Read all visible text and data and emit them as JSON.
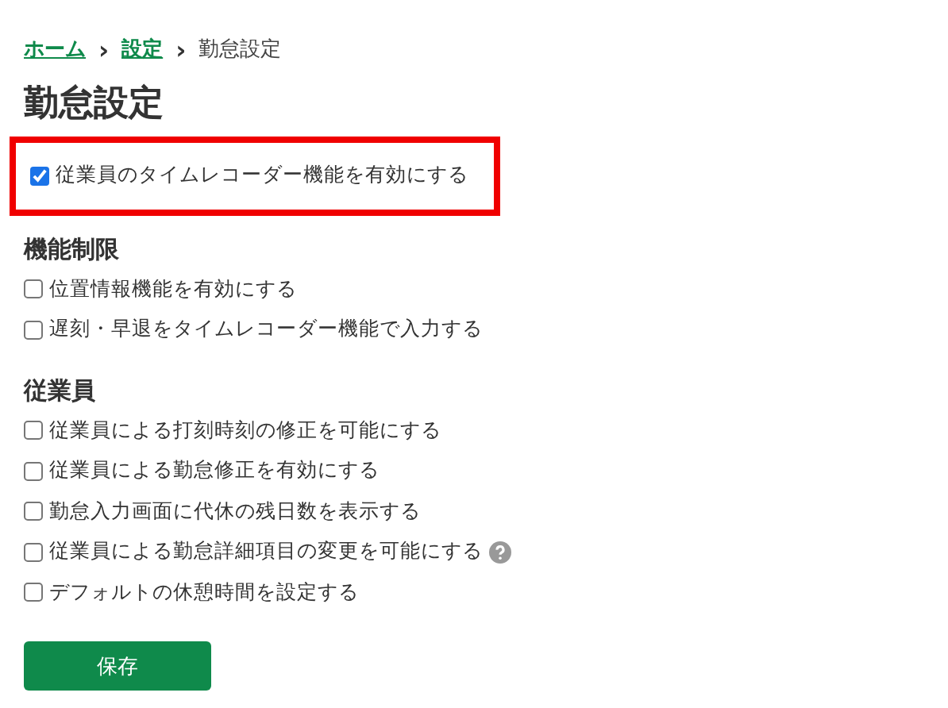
{
  "breadcrumb": [
    {
      "label": "ホーム",
      "link": true
    },
    {
      "label": "設定",
      "link": true
    },
    {
      "label": "勤怠設定",
      "link": false
    }
  ],
  "breadcrumb_separator": "›",
  "title": "勤怠設定",
  "main_option": {
    "label": "従業員のタイムレコーダー機能を有効にする",
    "checked": true,
    "highlighted": true
  },
  "sections": [
    {
      "heading": "機能制限",
      "options": [
        {
          "label": "位置情報機能を有効にする",
          "checked": false,
          "help": false
        },
        {
          "label": "遅刻・早退をタイムレコーダー機能で入力する",
          "checked": false,
          "help": false
        }
      ]
    },
    {
      "heading": "従業員",
      "options": [
        {
          "label": "従業員による打刻時刻の修正を可能にする",
          "checked": false,
          "help": false
        },
        {
          "label": "従業員による勤怠修正を有効にする",
          "checked": false,
          "help": false
        },
        {
          "label": "勤怠入力画面に代休の残日数を表示する",
          "checked": false,
          "help": false
        },
        {
          "label": "従業員による勤怠詳細項目の変更を可能にする",
          "checked": false,
          "help": true
        },
        {
          "label": "デフォルトの休憩時間を設定する",
          "checked": false,
          "help": false
        }
      ]
    }
  ],
  "save_button": "保存"
}
